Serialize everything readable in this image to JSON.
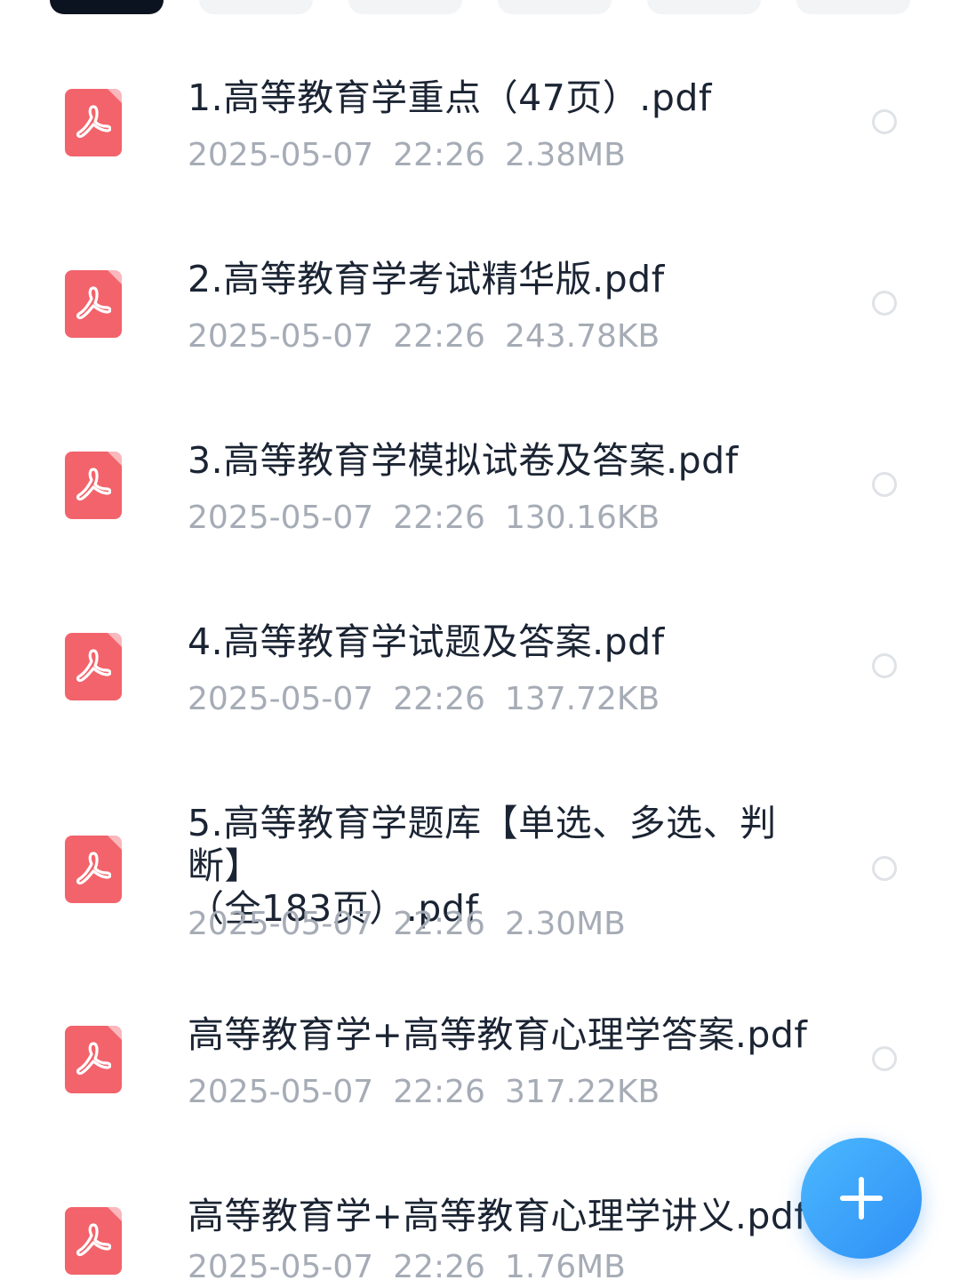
{
  "filter_chips": {
    "count": 6
  },
  "files": [
    {
      "name": "1.高等教育学重点（47页）.pdf",
      "date": "2025-05-07",
      "time": "22:26",
      "size": "2.38MB"
    },
    {
      "name": "2.高等教育学考试精华版.pdf",
      "date": "2025-05-07",
      "time": "22:26",
      "size": "243.78KB"
    },
    {
      "name": "3.高等教育学模拟试卷及答案.pdf",
      "date": "2025-05-07",
      "time": "22:26",
      "size": "130.16KB"
    },
    {
      "name": "4.高等教育学试题及答案.pdf",
      "date": "2025-05-07",
      "time": "22:26",
      "size": "137.72KB"
    },
    {
      "name": "5.高等教育学题库【单选、多选、判断】\n（全183页）.pdf",
      "date": "2025-05-07",
      "time": "22:26",
      "size": "2.30MB"
    },
    {
      "name": "高等教育学+高等教育心理学答案.pdf",
      "date": "2025-05-07",
      "time": "22:26",
      "size": "317.22KB"
    },
    {
      "name": "高等教育学+高等教育心理学讲义.pdf",
      "date": "2025-05-07",
      "time": "22:26",
      "size": "1.76MB"
    }
  ],
  "icons": {
    "file": "pdf-file-icon",
    "select": "radio-unchecked-icon",
    "fab": "plus-icon"
  },
  "colors": {
    "pdf_icon": "#f2636b",
    "fab": "#2f8ff5",
    "meta_text": "#a6acb6",
    "name_text": "#1b2433"
  }
}
